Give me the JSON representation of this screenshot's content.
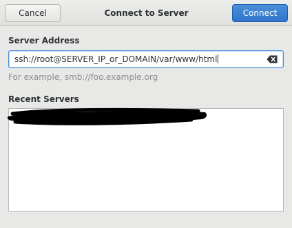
{
  "header": {
    "cancel_label": "Cancel",
    "title": "Connect to Server",
    "connect_label": "Connect"
  },
  "server_address": {
    "label": "Server Address",
    "value": "ssh://root@SERVER_IP_or_DOMAIN/var/www/html",
    "clear_icon": "backspace-clear-icon",
    "hint": "For example, smb://foo.example.org"
  },
  "recent_servers": {
    "label": "Recent Servers",
    "items_redacted": true
  },
  "colors": {
    "accent": "#4a90d9",
    "background": "#e8e8e7",
    "hint_text": "#8b8e8f"
  }
}
